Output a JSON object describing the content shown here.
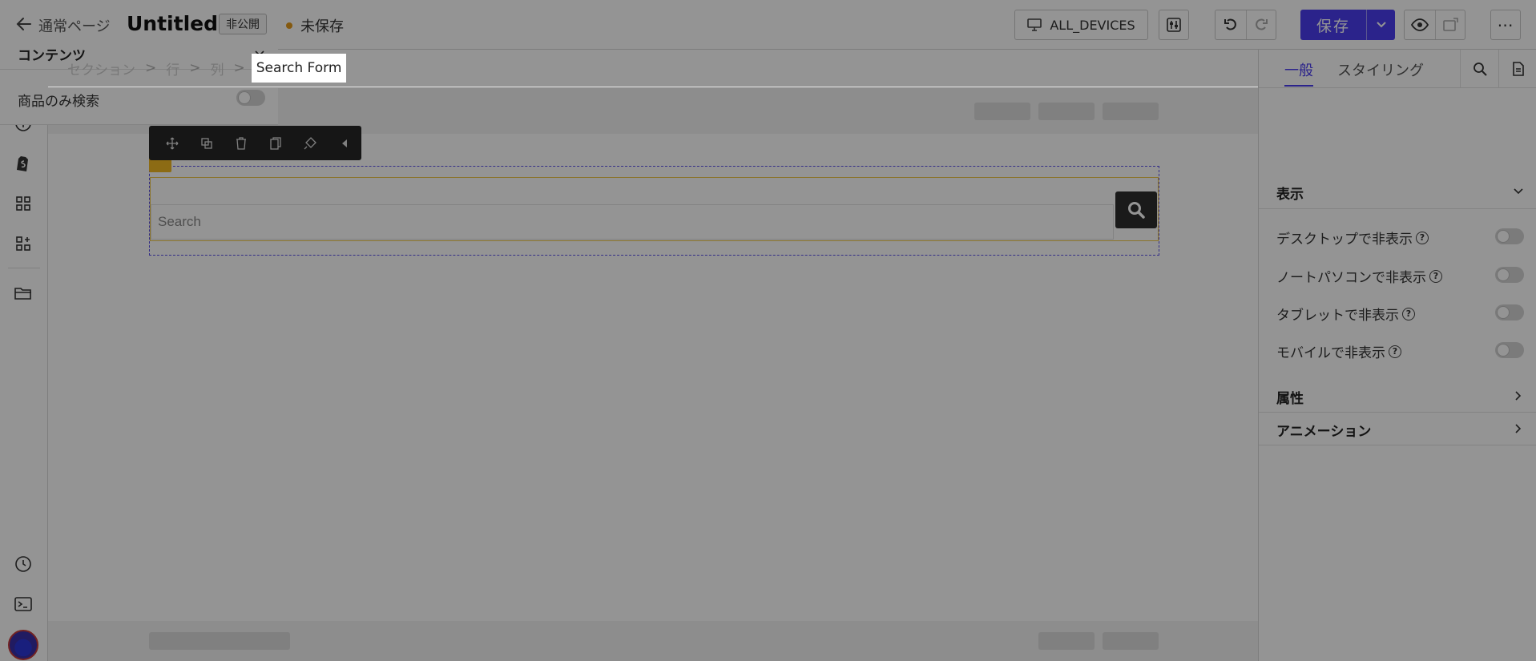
{
  "topbar": {
    "page_type": "通常ページ",
    "title": "Untitled",
    "visibility": "非公開",
    "status": "未保存",
    "device": "ALL_DEVICES",
    "save_label": "保存",
    "more": "⋯",
    "colors": {
      "accent": "#4a3df0",
      "status_dot": "#e39a1a"
    }
  },
  "breadcrumb": {
    "items": [
      "セクション",
      "行",
      "列"
    ],
    "current": "Search Form"
  },
  "canvas": {
    "search_placeholder": "Search",
    "toolbar_icons": [
      "move-icon",
      "duplicate-icon",
      "delete-icon",
      "copy-icon",
      "style-icon",
      "collapse-icon"
    ]
  },
  "panel": {
    "tabs": [
      "一般",
      "スタイリング"
    ],
    "content_section": {
      "title": "コンテンツ",
      "rows": [
        {
          "label": "商品のみ検索",
          "on": false
        }
      ]
    },
    "display_section": {
      "title": "表示",
      "rows": [
        {
          "label": "デスクトップで非表示",
          "on": false
        },
        {
          "label": "ノートパソコンで非表示",
          "on": false
        },
        {
          "label": "タブレットで非表示",
          "on": false
        },
        {
          "label": "モバイルで非表示",
          "on": false
        }
      ]
    },
    "attributes_section": {
      "title": "属性"
    },
    "animation_section": {
      "title": "アニメーション"
    }
  }
}
